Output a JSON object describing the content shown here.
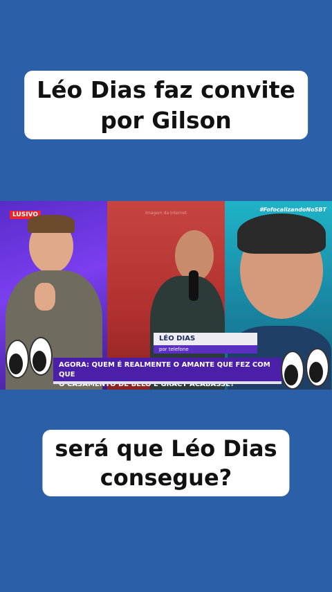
{
  "caption_top": {
    "line1": "Léo Dias faz convite",
    "line2": "por Gilson"
  },
  "video": {
    "left_tag": "LUSIVO",
    "watermark": "Imagem da Internet",
    "hashtag": "#FofocalizandoNoSBT",
    "lower_third": {
      "name": "LÉO DIAS",
      "subtitle": "por telefone"
    },
    "ticker": {
      "line1": "AGORA: QUEM É REALMENTE O AMANTE QUE FEZ COM QUE",
      "line2": "O CASAMENTO DE BELO E GRACY ACABASSE?"
    }
  },
  "caption_bottom": {
    "line1": "será que Léo Dias",
    "line2": "consegue?"
  },
  "colors": {
    "background": "#2b5fa8",
    "caption_bg": "#ffffff",
    "ticker_bg": "#4b1fa8",
    "tag_red": "#e8262b"
  },
  "icons": [
    "eyes-emoji-left",
    "eyes-emoji-right"
  ]
}
